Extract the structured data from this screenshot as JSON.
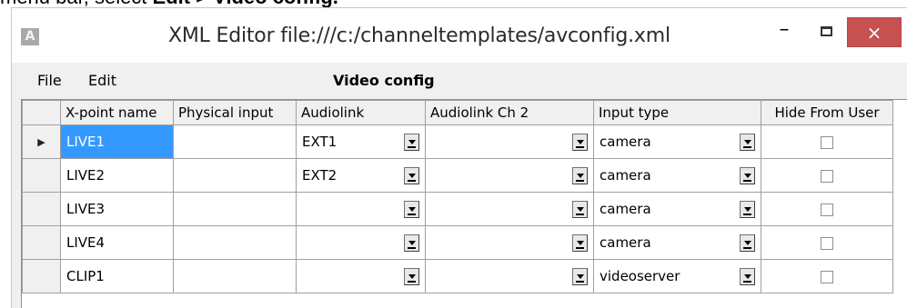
{
  "caption": {
    "prefix": "menu bar, select ",
    "bold": "Edit > Video config."
  },
  "window": {
    "title": "XML Editor file:///c:/channeltemplates/avconfig.xml",
    "app_icon_letter": "A",
    "minimize": "–",
    "close": "×"
  },
  "menu": {
    "file": "File",
    "edit": "Edit",
    "section_title": "Video config"
  },
  "grid": {
    "columns": [
      "X-point name",
      "Physical input",
      "Audiolink",
      "Audiolink Ch 2",
      "Input type",
      "Hide From User"
    ],
    "current_row_marker": "▶",
    "rows": [
      {
        "name": "LIVE1",
        "physical": "",
        "audiolink": "EXT1",
        "audiolink2": "",
        "input_type": "camera",
        "hide": false
      },
      {
        "name": "LIVE2",
        "physical": "",
        "audiolink": "EXT2",
        "audiolink2": "",
        "input_type": "camera",
        "hide": false
      },
      {
        "name": "LIVE3",
        "physical": "",
        "audiolink": "",
        "audiolink2": "",
        "input_type": "camera",
        "hide": false
      },
      {
        "name": "LIVE4",
        "physical": "",
        "audiolink": "",
        "audiolink2": "",
        "input_type": "camera",
        "hide": false
      },
      {
        "name": "CLIP1",
        "physical": "",
        "audiolink": "",
        "audiolink2": "",
        "input_type": "videoserver",
        "hide": false
      }
    ]
  },
  "colors": {
    "selection": "#3399ff",
    "close_button": "#c75050"
  }
}
